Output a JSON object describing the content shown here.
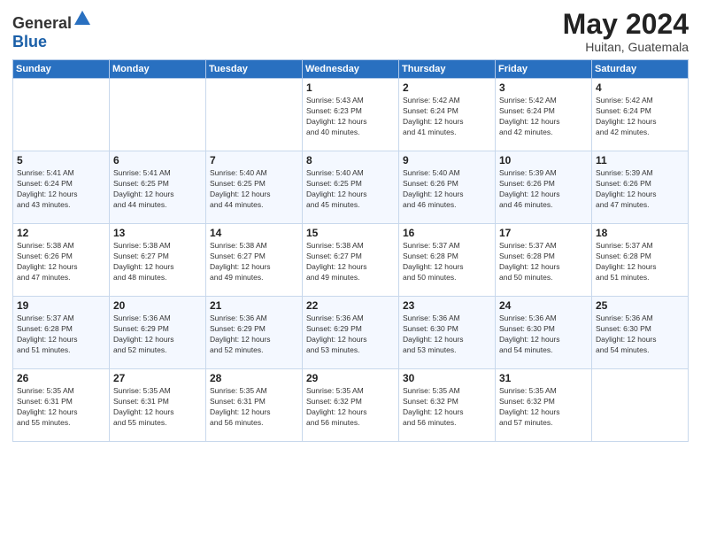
{
  "header": {
    "logo_general": "General",
    "logo_blue": "Blue",
    "month_title": "May 2024",
    "location": "Huitan, Guatemala"
  },
  "weekdays": [
    "Sunday",
    "Monday",
    "Tuesday",
    "Wednesday",
    "Thursday",
    "Friday",
    "Saturday"
  ],
  "weeks": [
    [
      {
        "day": "",
        "info": ""
      },
      {
        "day": "",
        "info": ""
      },
      {
        "day": "",
        "info": ""
      },
      {
        "day": "1",
        "info": "Sunrise: 5:43 AM\nSunset: 6:23 PM\nDaylight: 12 hours\nand 40 minutes."
      },
      {
        "day": "2",
        "info": "Sunrise: 5:42 AM\nSunset: 6:24 PM\nDaylight: 12 hours\nand 41 minutes."
      },
      {
        "day": "3",
        "info": "Sunrise: 5:42 AM\nSunset: 6:24 PM\nDaylight: 12 hours\nand 42 minutes."
      },
      {
        "day": "4",
        "info": "Sunrise: 5:42 AM\nSunset: 6:24 PM\nDaylight: 12 hours\nand 42 minutes."
      }
    ],
    [
      {
        "day": "5",
        "info": "Sunrise: 5:41 AM\nSunset: 6:24 PM\nDaylight: 12 hours\nand 43 minutes."
      },
      {
        "day": "6",
        "info": "Sunrise: 5:41 AM\nSunset: 6:25 PM\nDaylight: 12 hours\nand 44 minutes."
      },
      {
        "day": "7",
        "info": "Sunrise: 5:40 AM\nSunset: 6:25 PM\nDaylight: 12 hours\nand 44 minutes."
      },
      {
        "day": "8",
        "info": "Sunrise: 5:40 AM\nSunset: 6:25 PM\nDaylight: 12 hours\nand 45 minutes."
      },
      {
        "day": "9",
        "info": "Sunrise: 5:40 AM\nSunset: 6:26 PM\nDaylight: 12 hours\nand 46 minutes."
      },
      {
        "day": "10",
        "info": "Sunrise: 5:39 AM\nSunset: 6:26 PM\nDaylight: 12 hours\nand 46 minutes."
      },
      {
        "day": "11",
        "info": "Sunrise: 5:39 AM\nSunset: 6:26 PM\nDaylight: 12 hours\nand 47 minutes."
      }
    ],
    [
      {
        "day": "12",
        "info": "Sunrise: 5:38 AM\nSunset: 6:26 PM\nDaylight: 12 hours\nand 47 minutes."
      },
      {
        "day": "13",
        "info": "Sunrise: 5:38 AM\nSunset: 6:27 PM\nDaylight: 12 hours\nand 48 minutes."
      },
      {
        "day": "14",
        "info": "Sunrise: 5:38 AM\nSunset: 6:27 PM\nDaylight: 12 hours\nand 49 minutes."
      },
      {
        "day": "15",
        "info": "Sunrise: 5:38 AM\nSunset: 6:27 PM\nDaylight: 12 hours\nand 49 minutes."
      },
      {
        "day": "16",
        "info": "Sunrise: 5:37 AM\nSunset: 6:28 PM\nDaylight: 12 hours\nand 50 minutes."
      },
      {
        "day": "17",
        "info": "Sunrise: 5:37 AM\nSunset: 6:28 PM\nDaylight: 12 hours\nand 50 minutes."
      },
      {
        "day": "18",
        "info": "Sunrise: 5:37 AM\nSunset: 6:28 PM\nDaylight: 12 hours\nand 51 minutes."
      }
    ],
    [
      {
        "day": "19",
        "info": "Sunrise: 5:37 AM\nSunset: 6:28 PM\nDaylight: 12 hours\nand 51 minutes."
      },
      {
        "day": "20",
        "info": "Sunrise: 5:36 AM\nSunset: 6:29 PM\nDaylight: 12 hours\nand 52 minutes."
      },
      {
        "day": "21",
        "info": "Sunrise: 5:36 AM\nSunset: 6:29 PM\nDaylight: 12 hours\nand 52 minutes."
      },
      {
        "day": "22",
        "info": "Sunrise: 5:36 AM\nSunset: 6:29 PM\nDaylight: 12 hours\nand 53 minutes."
      },
      {
        "day": "23",
        "info": "Sunrise: 5:36 AM\nSunset: 6:30 PM\nDaylight: 12 hours\nand 53 minutes."
      },
      {
        "day": "24",
        "info": "Sunrise: 5:36 AM\nSunset: 6:30 PM\nDaylight: 12 hours\nand 54 minutes."
      },
      {
        "day": "25",
        "info": "Sunrise: 5:36 AM\nSunset: 6:30 PM\nDaylight: 12 hours\nand 54 minutes."
      }
    ],
    [
      {
        "day": "26",
        "info": "Sunrise: 5:35 AM\nSunset: 6:31 PM\nDaylight: 12 hours\nand 55 minutes."
      },
      {
        "day": "27",
        "info": "Sunrise: 5:35 AM\nSunset: 6:31 PM\nDaylight: 12 hours\nand 55 minutes."
      },
      {
        "day": "28",
        "info": "Sunrise: 5:35 AM\nSunset: 6:31 PM\nDaylight: 12 hours\nand 56 minutes."
      },
      {
        "day": "29",
        "info": "Sunrise: 5:35 AM\nSunset: 6:32 PM\nDaylight: 12 hours\nand 56 minutes."
      },
      {
        "day": "30",
        "info": "Sunrise: 5:35 AM\nSunset: 6:32 PM\nDaylight: 12 hours\nand 56 minutes."
      },
      {
        "day": "31",
        "info": "Sunrise: 5:35 AM\nSunset: 6:32 PM\nDaylight: 12 hours\nand 57 minutes."
      },
      {
        "day": "",
        "info": ""
      }
    ]
  ]
}
